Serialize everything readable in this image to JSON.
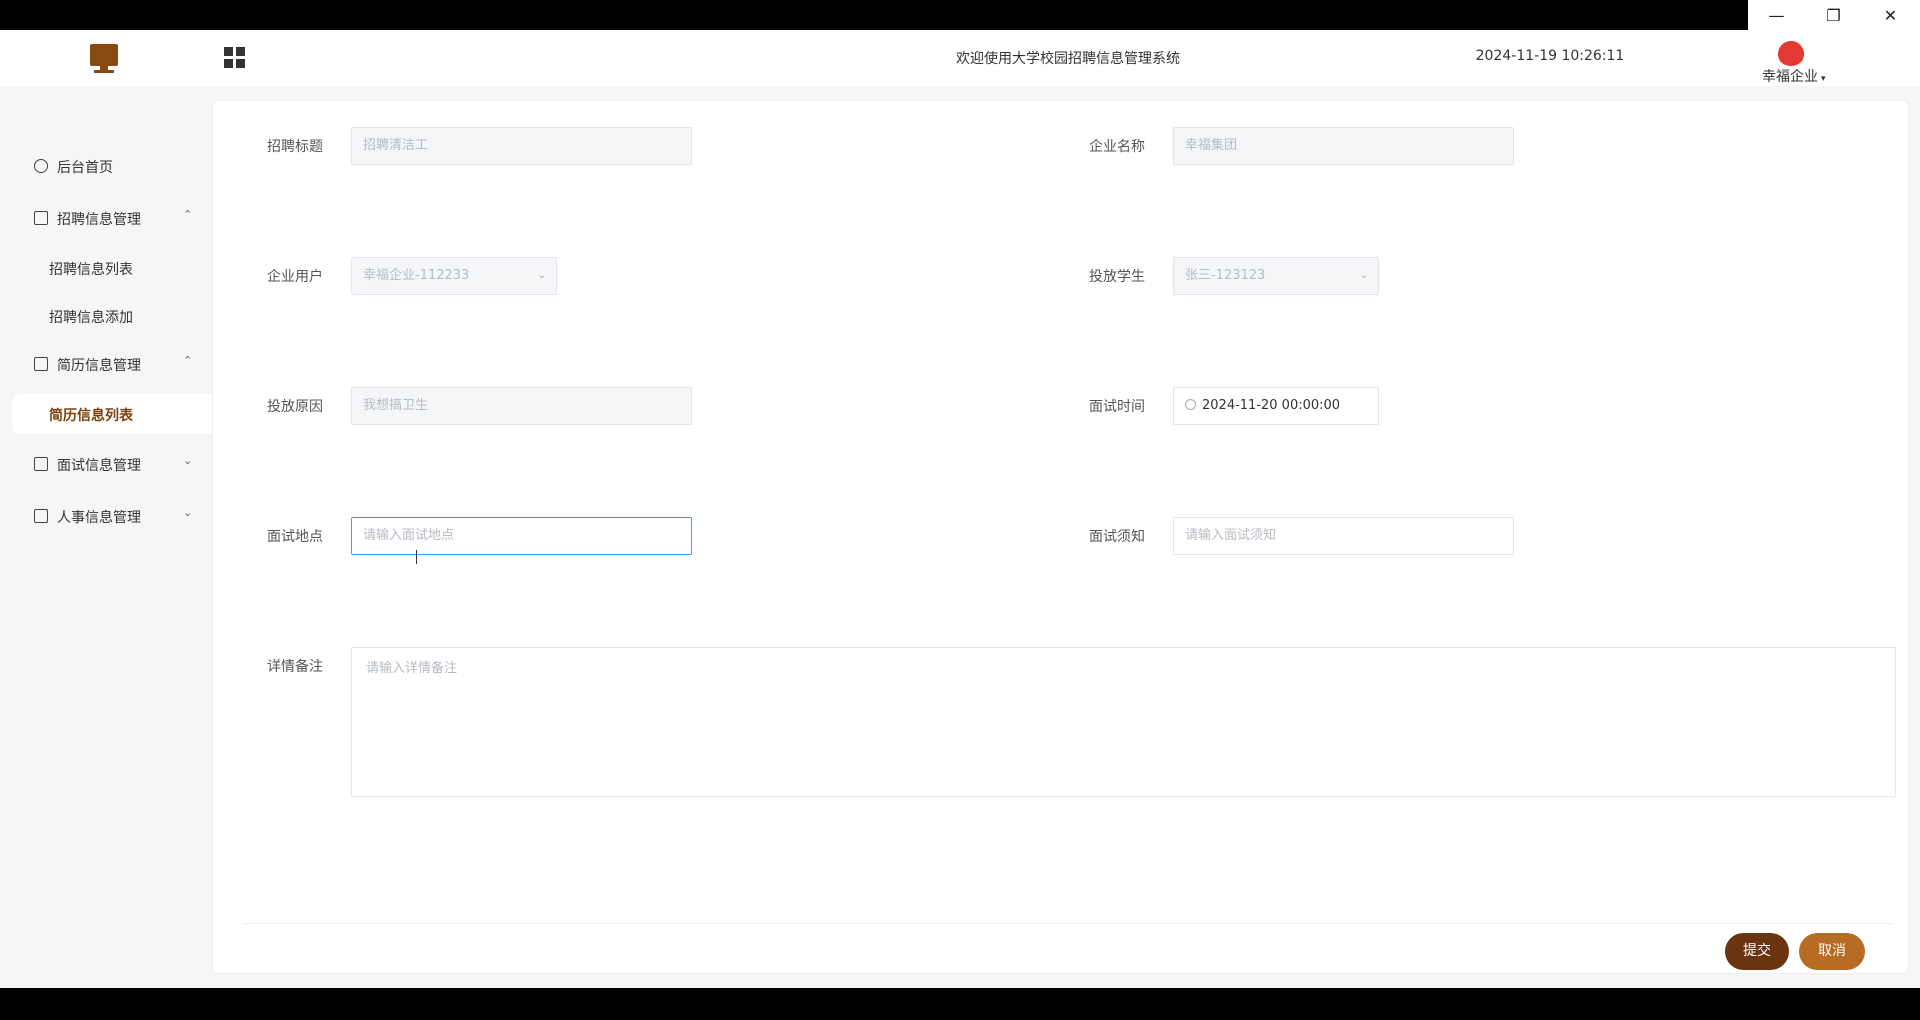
{
  "window": {
    "minimize_icon": "minimize-icon",
    "maximize_icon": "restore-icon",
    "close_icon": "close-icon"
  },
  "header": {
    "title": "欢迎使用大学校园招聘信息管理系统",
    "datetime": "2024-11-19 10:26:11",
    "user_name": "幸福企业"
  },
  "sidebar": {
    "home": "后台首页",
    "recruit_mgmt": "招聘信息管理",
    "recruit_list": "招聘信息列表",
    "recruit_add": "招聘信息添加",
    "resume_mgmt": "简历信息管理",
    "resume_list": "简历信息列表",
    "interview_mgmt": "面试信息管理",
    "hr_mgmt": "人事信息管理"
  },
  "form": {
    "recruit_title": {
      "label": "招聘标题",
      "value": "招聘清洁工"
    },
    "company_name": {
      "label": "企业名称",
      "value": "幸福集团"
    },
    "company_user": {
      "label": "企业用户",
      "value": "幸福企业-112233"
    },
    "student": {
      "label": "投放学生",
      "value": "张三-123123"
    },
    "reason": {
      "label": "投放原因",
      "value": "我想搞卫生"
    },
    "interview_time": {
      "label": "面试时间",
      "value": "2024-11-20 00:00:00"
    },
    "interview_place": {
      "label": "面试地点",
      "placeholder": "请输入面试地点"
    },
    "interview_notice": {
      "label": "面试须知",
      "placeholder": "请输入面试须知"
    },
    "remarks": {
      "label": "详情备注",
      "placeholder": "请输入详情备注"
    }
  },
  "actions": {
    "submit": "提交",
    "cancel": "取消"
  }
}
